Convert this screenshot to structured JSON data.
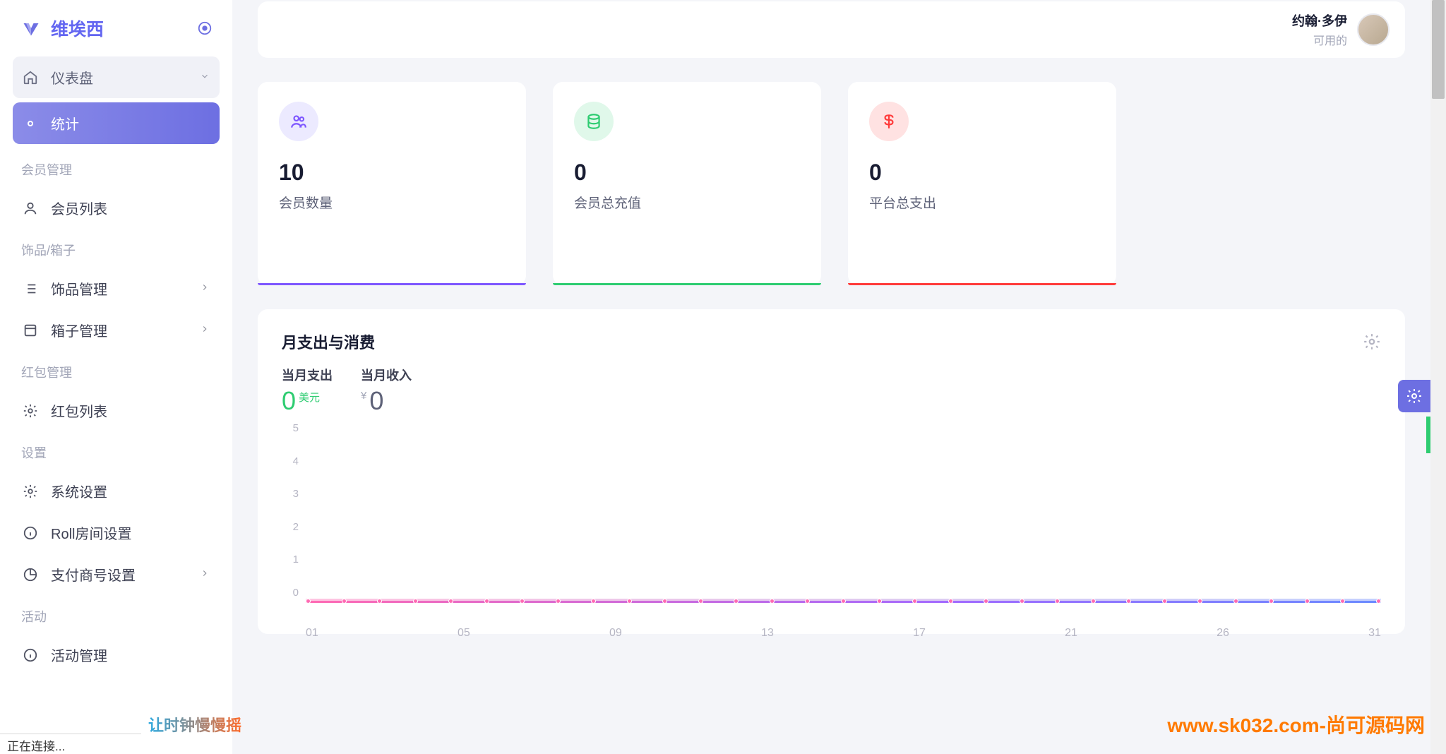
{
  "brand": {
    "name": "维埃西"
  },
  "user": {
    "name": "约翰·多伊",
    "status": "可用的"
  },
  "sidebar": {
    "dashboard": "仪表盘",
    "stats": "统计",
    "sections": {
      "member": "会员管理",
      "ornament": "饰品/箱子",
      "redpacket": "红包管理",
      "settings": "设置",
      "activity": "活动"
    },
    "items": {
      "member_list": "会员列表",
      "ornament_manage": "饰品管理",
      "box_manage": "箱子管理",
      "redpacket_list": "红包列表",
      "system_settings": "系统设置",
      "roll_room": "Roll房间设置",
      "payment": "支付商号设置",
      "activity_manage": "活动管理"
    }
  },
  "stats": {
    "card1": {
      "value": "10",
      "label": "会员数量"
    },
    "card2": {
      "value": "0",
      "label": "会员总充值"
    },
    "card3": {
      "value": "0",
      "label": "平台总支出"
    }
  },
  "chart": {
    "title": "月支出与消费",
    "metric1": {
      "label": "当月支出",
      "value": "0",
      "currency": "美元"
    },
    "metric2": {
      "label": "当月收入",
      "value": "0",
      "currency": "¥"
    }
  },
  "chart_data": {
    "type": "line",
    "title": "月支出与消费",
    "xlabel": "",
    "ylabel": "",
    "ylim": [
      0,
      5
    ],
    "y_ticks": [
      5,
      4,
      3,
      2,
      1,
      0
    ],
    "x_labels": [
      "01",
      "05",
      "09",
      "13",
      "17",
      "21",
      "26",
      "31"
    ],
    "series": [
      {
        "name": "当月支出",
        "values": [
          0,
          0,
          0,
          0,
          0,
          0,
          0,
          0,
          0,
          0,
          0,
          0,
          0,
          0,
          0,
          0,
          0,
          0,
          0,
          0,
          0,
          0,
          0,
          0,
          0,
          0,
          0,
          0,
          0,
          0,
          0
        ]
      },
      {
        "name": "当月收入",
        "values": [
          0,
          0,
          0,
          0,
          0,
          0,
          0,
          0,
          0,
          0,
          0,
          0,
          0,
          0,
          0,
          0,
          0,
          0,
          0,
          0,
          0,
          0,
          0,
          0,
          0,
          0,
          0,
          0,
          0,
          0,
          0
        ]
      }
    ]
  },
  "status_bar": "正在连接...",
  "watermark1": "让时钟慢慢摇",
  "watermark2": "www.sk032.com-尚可源码网"
}
